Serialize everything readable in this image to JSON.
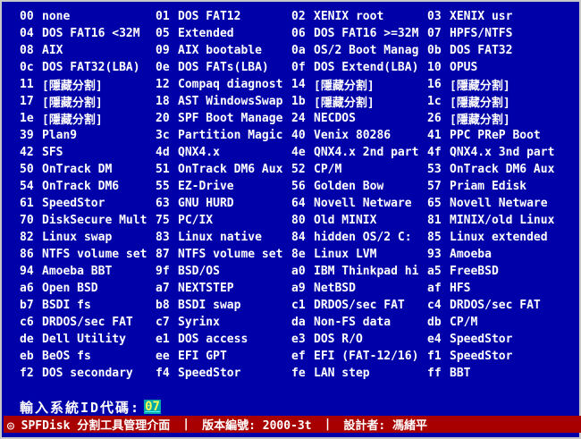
{
  "entries": [
    {
      "code": "00",
      "name": "none"
    },
    {
      "code": "01",
      "name": "DOS FAT12"
    },
    {
      "code": "02",
      "name": "XENIX root"
    },
    {
      "code": "03",
      "name": "XENIX usr"
    },
    {
      "code": "04",
      "name": "DOS FAT16 <32M"
    },
    {
      "code": "05",
      "name": "Extended"
    },
    {
      "code": "06",
      "name": "DOS FAT16 >=32M"
    },
    {
      "code": "07",
      "name": "HPFS/NTFS"
    },
    {
      "code": "08",
      "name": "AIX"
    },
    {
      "code": "09",
      "name": "AIX bootable"
    },
    {
      "code": "0a",
      "name": "OS/2 Boot Manag"
    },
    {
      "code": "0b",
      "name": "DOS FAT32"
    },
    {
      "code": "0c",
      "name": "DOS FAT32(LBA)"
    },
    {
      "code": "0e",
      "name": "DOS FATs(LBA)"
    },
    {
      "code": "0f",
      "name": "DOS Extend(LBA)"
    },
    {
      "code": "10",
      "name": "OPUS"
    },
    {
      "code": "11",
      "name": "[隱藏分割]"
    },
    {
      "code": "12",
      "name": "Compaq diagnost"
    },
    {
      "code": "14",
      "name": "[隱藏分割]"
    },
    {
      "code": "16",
      "name": "[隱藏分割]"
    },
    {
      "code": "17",
      "name": "[隱藏分割]"
    },
    {
      "code": "18",
      "name": "AST WindowsSwap"
    },
    {
      "code": "1b",
      "name": "[隱藏分割]"
    },
    {
      "code": "1c",
      "name": "[隱藏分割]"
    },
    {
      "code": "1e",
      "name": "[隱藏分割]"
    },
    {
      "code": "20",
      "name": "SPF Boot Manage"
    },
    {
      "code": "24",
      "name": "NECDOS"
    },
    {
      "code": "26",
      "name": "[隱藏分割]"
    },
    {
      "code": "39",
      "name": "Plan9"
    },
    {
      "code": "3c",
      "name": "Partition Magic"
    },
    {
      "code": "40",
      "name": "Venix 80286"
    },
    {
      "code": "41",
      "name": "PPC PReP Boot"
    },
    {
      "code": "42",
      "name": "SFS"
    },
    {
      "code": "4d",
      "name": "QNX4.x"
    },
    {
      "code": "4e",
      "name": "QNX4.x 2nd part"
    },
    {
      "code": "4f",
      "name": "QNX4.x 3nd part"
    },
    {
      "code": "50",
      "name": "OnTrack DM"
    },
    {
      "code": "51",
      "name": "OnTrack DM6 Aux"
    },
    {
      "code": "52",
      "name": "CP/M"
    },
    {
      "code": "53",
      "name": "OnTrack DM6 Aux"
    },
    {
      "code": "54",
      "name": "OnTrack DM6"
    },
    {
      "code": "55",
      "name": "EZ-Drive"
    },
    {
      "code": "56",
      "name": "Golden Bow"
    },
    {
      "code": "57",
      "name": "Priam Edisk"
    },
    {
      "code": "61",
      "name": "SpeedStor"
    },
    {
      "code": "63",
      "name": "GNU HURD"
    },
    {
      "code": "64",
      "name": "Novell Netware"
    },
    {
      "code": "65",
      "name": "Novell Netware"
    },
    {
      "code": "70",
      "name": "DiskSecure Mult"
    },
    {
      "code": "75",
      "name": "PC/IX"
    },
    {
      "code": "80",
      "name": "Old MINIX"
    },
    {
      "code": "81",
      "name": "MINIX/old Linux"
    },
    {
      "code": "82",
      "name": "Linux swap"
    },
    {
      "code": "83",
      "name": "Linux native"
    },
    {
      "code": "84",
      "name": "hidden OS/2 C:"
    },
    {
      "code": "85",
      "name": "Linux extended"
    },
    {
      "code": "86",
      "name": "NTFS volume set"
    },
    {
      "code": "87",
      "name": "NTFS volume set"
    },
    {
      "code": "8e",
      "name": "Linux LVM"
    },
    {
      "code": "93",
      "name": "Amoeba"
    },
    {
      "code": "94",
      "name": "Amoeba BBT"
    },
    {
      "code": "9f",
      "name": "BSD/OS"
    },
    {
      "code": "a0",
      "name": "IBM Thinkpad hi"
    },
    {
      "code": "a5",
      "name": "FreeBSD"
    },
    {
      "code": "a6",
      "name": "Open BSD"
    },
    {
      "code": "a7",
      "name": "NEXTSTEP"
    },
    {
      "code": "a9",
      "name": "NetBSD"
    },
    {
      "code": "af",
      "name": "HFS"
    },
    {
      "code": "b7",
      "name": "BSDI fs"
    },
    {
      "code": "b8",
      "name": "BSDI swap"
    },
    {
      "code": "c1",
      "name": "DRDOS/sec FAT"
    },
    {
      "code": "c4",
      "name": "DRDOS/sec FAT"
    },
    {
      "code": "c6",
      "name": "DRDOS/sec FAT"
    },
    {
      "code": "c7",
      "name": "Syrinx"
    },
    {
      "code": "da",
      "name": "Non-FS data"
    },
    {
      "code": "db",
      "name": "CP/M"
    },
    {
      "code": "de",
      "name": "Dell Utility"
    },
    {
      "code": "e1",
      "name": "DOS access"
    },
    {
      "code": "e3",
      "name": "DOS R/O"
    },
    {
      "code": "e4",
      "name": "SpeedStor"
    },
    {
      "code": "eb",
      "name": "BeOS fs"
    },
    {
      "code": "ee",
      "name": "EFI GPT"
    },
    {
      "code": "ef",
      "name": "EFI (FAT-12/16)"
    },
    {
      "code": "f1",
      "name": "SpeedStor"
    },
    {
      "code": "f2",
      "name": "DOS secondary"
    },
    {
      "code": "f4",
      "name": "SpeedStor"
    },
    {
      "code": "fe",
      "name": "LAN step"
    },
    {
      "code": "ff",
      "name": "BBT"
    }
  ],
  "prompt": {
    "label": "輸入系統ID代碼:",
    "value": "07"
  },
  "status": {
    "app": "◎ SPFDisk 分割工具管理介面",
    "sep": "|",
    "version": "版本編號: 2000-3t",
    "designer": "設計者: 馮緒平"
  },
  "colors": {
    "background": "#0000a8",
    "text": "#ffffff",
    "status_bar": "#a80000",
    "input_bg": "#00a8a8",
    "input_text": "#ffff55"
  }
}
